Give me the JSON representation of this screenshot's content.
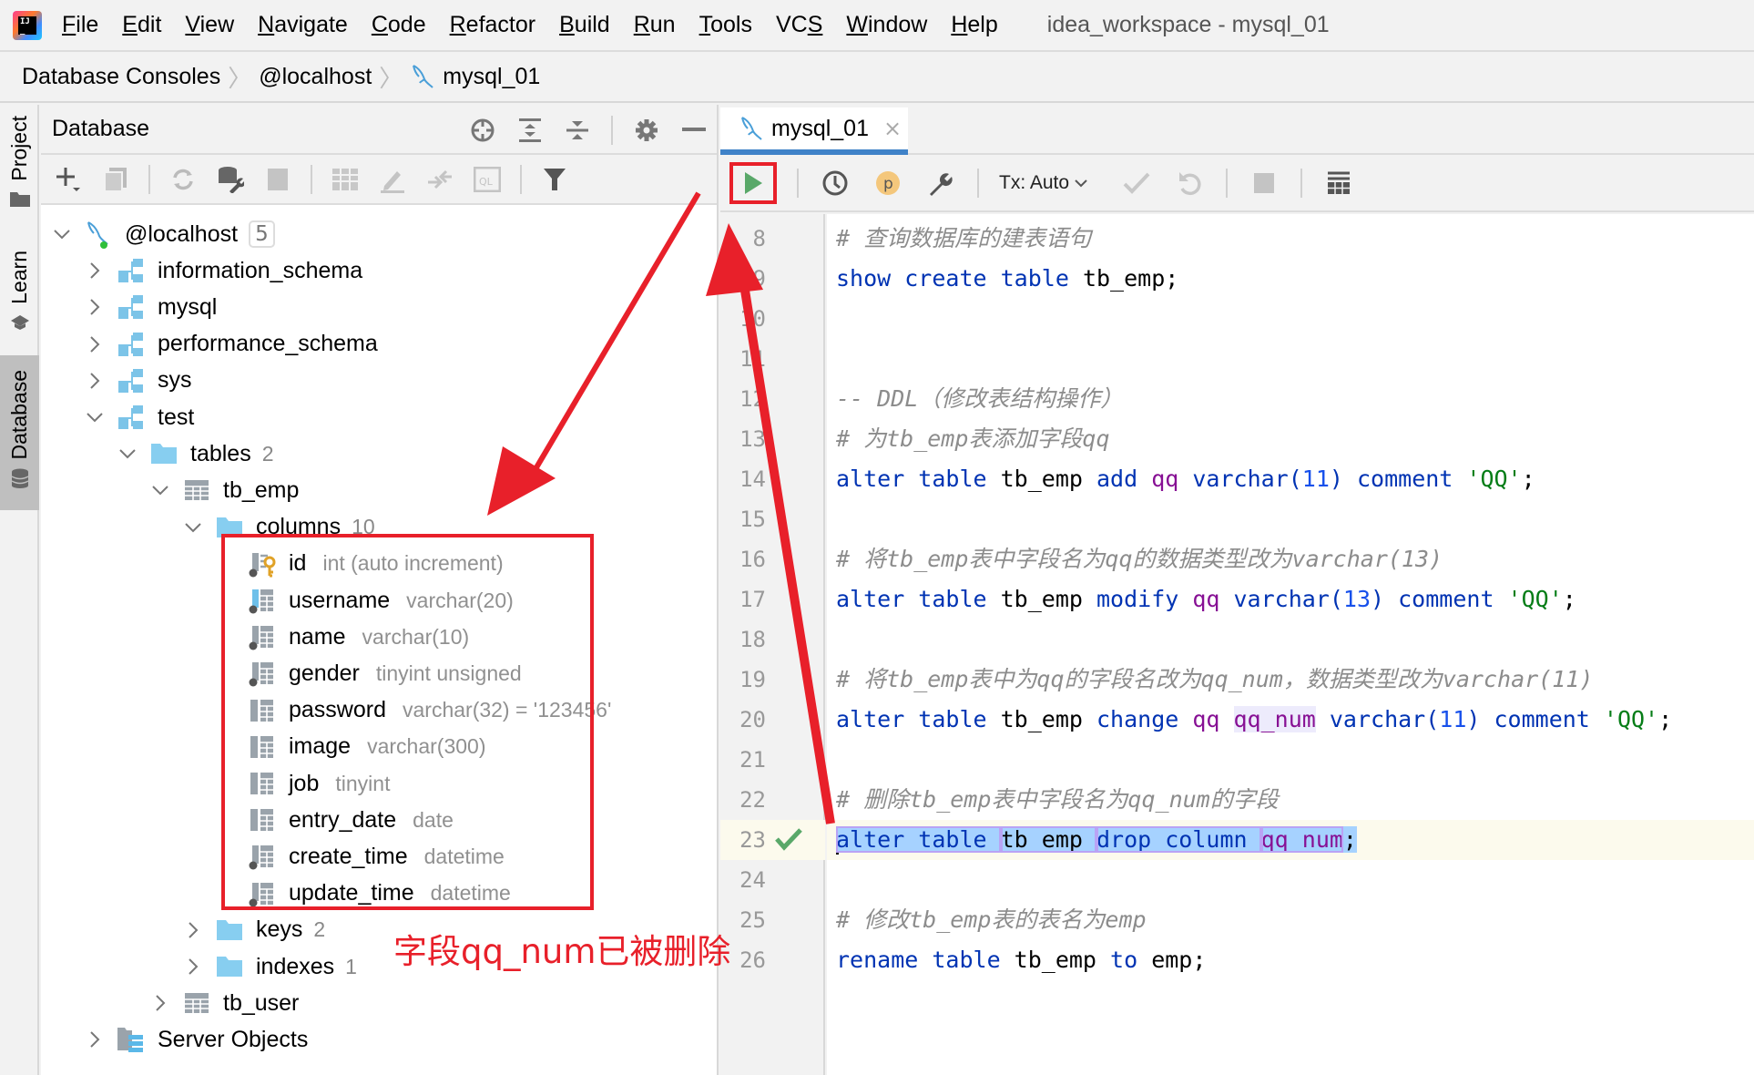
{
  "menubar": {
    "items": [
      {
        "label": "File",
        "mnemonic": "F",
        "rest": "ile"
      },
      {
        "label": "Edit",
        "mnemonic": "E",
        "rest": "dit"
      },
      {
        "label": "View",
        "mnemonic": "V",
        "rest": "iew"
      },
      {
        "label": "Navigate",
        "mnemonic": "N",
        "rest": "avigate"
      },
      {
        "label": "Code",
        "mnemonic": "C",
        "rest": "ode"
      },
      {
        "label": "Refactor",
        "mnemonic": "R",
        "rest": "efactor"
      },
      {
        "label": "Build",
        "mnemonic": "B",
        "rest": "uild"
      },
      {
        "label": "Run",
        "mnemonic": "R",
        "rest": "un",
        "prefix": "",
        "ulIndex": 1
      },
      {
        "label": "Tools",
        "mnemonic": "T",
        "rest": "ools"
      },
      {
        "label": "VCS",
        "mnemonic": "S",
        "rest": "",
        "prefix": "VC"
      },
      {
        "label": "Window",
        "mnemonic": "W",
        "rest": "indow"
      },
      {
        "label": "Help",
        "mnemonic": "H",
        "rest": "elp"
      }
    ],
    "window_title": "idea_workspace - mysql_01"
  },
  "breadcrumb": {
    "items": [
      "Database Consoles",
      "@localhost",
      "mysql_01"
    ]
  },
  "toolstrip": {
    "tabs": [
      {
        "label": "Project",
        "icon": "folder-icon",
        "active": false
      },
      {
        "label": "Learn",
        "icon": "graduation-cap-icon",
        "active": false
      },
      {
        "label": "Database",
        "icon": "database-icon",
        "active": true
      }
    ]
  },
  "db_panel": {
    "title": "Database",
    "header_icons": [
      "locate-icon",
      "expand-all-icon",
      "collapse-all-icon",
      "gear-icon",
      "minimize-icon"
    ],
    "toolbar_icons": [
      "add-icon",
      "duplicate-icon",
      "refresh-icon",
      "data-source-properties-icon",
      "stop-icon",
      "table-view-icon",
      "edit-icon",
      "jump-to-source-icon",
      "query-console-icon",
      "filter-icon"
    ],
    "tree": {
      "root": {
        "label": "@localhost",
        "count": "5"
      },
      "schemas": [
        "information_schema",
        "mysql",
        "performance_schema",
        "sys",
        "test"
      ],
      "tables_folder": {
        "label": "tables",
        "count": "2"
      },
      "table_tb_emp": "tb_emp",
      "columns_folder": {
        "label": "columns",
        "count": "10"
      },
      "columns": [
        {
          "name": "id",
          "type": "int (auto increment)"
        },
        {
          "name": "username",
          "type": "varchar(20)"
        },
        {
          "name": "name",
          "type": "varchar(10)"
        },
        {
          "name": "gender",
          "type": "tinyint unsigned"
        },
        {
          "name": "password",
          "type": "varchar(32) = '123456'"
        },
        {
          "name": "image",
          "type": "varchar(300)"
        },
        {
          "name": "job",
          "type": "tinyint"
        },
        {
          "name": "entry_date",
          "type": "date"
        },
        {
          "name": "create_time",
          "type": "datetime"
        },
        {
          "name": "update_time",
          "type": "datetime"
        }
      ],
      "keys_folder": {
        "label": "keys",
        "count": "2"
      },
      "indexes_folder": {
        "label": "indexes",
        "count": "1"
      },
      "table_tb_user": "tb_user",
      "server_objects": "Server Objects"
    }
  },
  "editor": {
    "tab": {
      "label": "mysql_01",
      "close": "×"
    },
    "toolbar": {
      "tx_label": "Tx: Auto",
      "icons": [
        "execute-icon",
        "history-icon",
        "parameters-icon",
        "settings-wrench-icon",
        "commit-icon",
        "rollback-icon",
        "cancel-icon",
        "output-icon"
      ]
    },
    "lines": [
      {
        "n": "8",
        "tokens": [
          [
            "cmt",
            "# 查询数据库的建表语句"
          ]
        ]
      },
      {
        "n": "9",
        "tokens": [
          [
            "kw",
            "show create table "
          ],
          [
            "",
            "tb_emp;"
          ]
        ]
      },
      {
        "n": "10",
        "tokens": []
      },
      {
        "n": "11",
        "tokens": []
      },
      {
        "n": "12",
        "tokens": [
          [
            "cmt",
            "-- DDL（修改表结构操作）"
          ]
        ]
      },
      {
        "n": "13",
        "tokens": [
          [
            "cmt",
            "# 为tb_emp表添加字段qq"
          ]
        ]
      },
      {
        "n": "14",
        "tokens": [
          [
            "kw",
            "alter table "
          ],
          [
            "",
            "tb_emp "
          ],
          [
            "kw",
            "add "
          ],
          [
            "id",
            "qq "
          ],
          [
            "kw",
            "varchar("
          ],
          [
            "num",
            "11"
          ],
          [
            "kw",
            ") comment "
          ],
          [
            "str",
            "'QQ'"
          ],
          [
            "",
            ";"
          ]
        ]
      },
      {
        "n": "15",
        "tokens": []
      },
      {
        "n": "16",
        "tokens": [
          [
            "cmt",
            "# 将tb_emp表中字段名为qq的数据类型改为varchar(13)"
          ]
        ]
      },
      {
        "n": "17",
        "tokens": [
          [
            "kw",
            "alter table "
          ],
          [
            "",
            "tb_emp "
          ],
          [
            "kw",
            "modify "
          ],
          [
            "id",
            "qq "
          ],
          [
            "kw",
            "varchar("
          ],
          [
            "num",
            "13"
          ],
          [
            "kw",
            ") comment "
          ],
          [
            "str",
            "'QQ'"
          ],
          [
            "",
            ";"
          ]
        ]
      },
      {
        "n": "18",
        "tokens": []
      },
      {
        "n": "19",
        "tokens": [
          [
            "cmt",
            "# 将tb_emp表中为qq的字段名改为qq_num，数据类型改为varchar(11)"
          ]
        ]
      },
      {
        "n": "20",
        "tokens": [
          [
            "kw",
            "alter table "
          ],
          [
            "",
            "tb_emp "
          ],
          [
            "kw",
            "change "
          ],
          [
            "id",
            "qq "
          ],
          [
            "id qq-hl",
            "qq_num"
          ],
          [
            "kw",
            " varchar("
          ],
          [
            "num",
            "11"
          ],
          [
            "kw",
            ") comment "
          ],
          [
            "str",
            "'QQ'"
          ],
          [
            "",
            ";"
          ]
        ]
      },
      {
        "n": "21",
        "tokens": []
      },
      {
        "n": "22",
        "tokens": [
          [
            "cmt",
            "# 删除tb_emp表中字段名为qq_num的字段"
          ]
        ]
      },
      {
        "n": "23",
        "tokens": [
          [
            "kw",
            "alter table "
          ],
          [
            "",
            "tb_emp "
          ],
          [
            "kw",
            "drop column "
          ],
          [
            "id",
            "qq_num"
          ],
          [
            "",
            ";"
          ]
        ],
        "current": true,
        "status": "success"
      },
      {
        "n": "24",
        "tokens": []
      },
      {
        "n": "25",
        "tokens": [
          [
            "cmt",
            "# 修改tb_emp表的表名为emp"
          ]
        ]
      },
      {
        "n": "26",
        "tokens": [
          [
            "kw",
            "rename table "
          ],
          [
            "",
            "tb_emp "
          ],
          [
            "kw",
            "to "
          ],
          [
            "",
            "emp;"
          ]
        ]
      }
    ]
  },
  "annotation": {
    "text": "字段qq_num已被删除",
    "color": "#e8202a"
  },
  "colors": {
    "keyword": "#0033b3",
    "identifier": "#871094",
    "number": "#1750eb",
    "string": "#067d17",
    "comment": "#8c8c8c",
    "tab_underline": "#3f82c8",
    "run_green": "#59a869",
    "folder_blue": "#87cef0"
  }
}
